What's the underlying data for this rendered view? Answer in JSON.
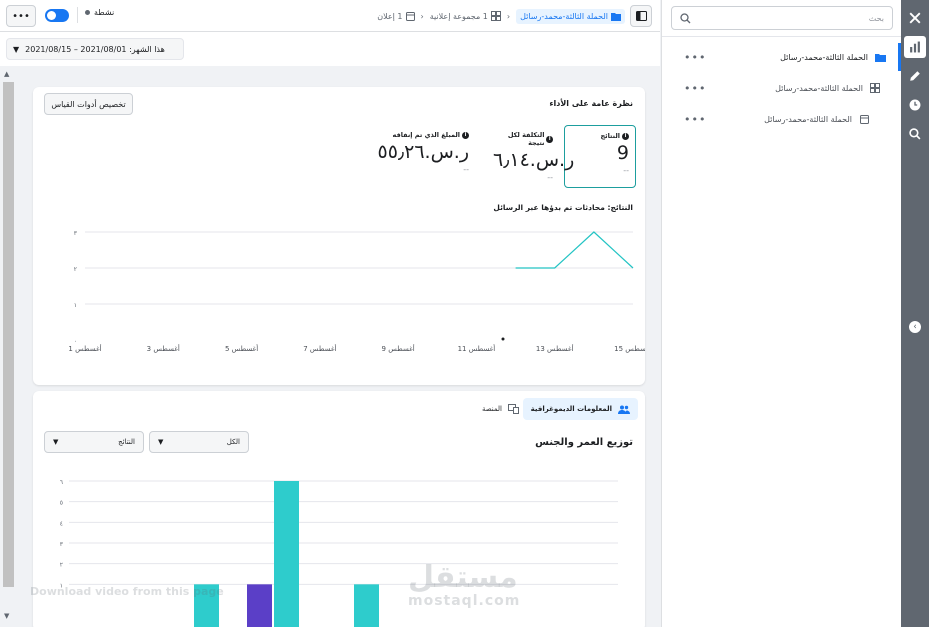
{
  "topbar": {
    "more_label": "•••",
    "status_label": "نشطة",
    "breadcrumbs": [
      {
        "label": "الحملة الثالثة-محمد-رسائل",
        "icon": "folder-icon"
      },
      {
        "label": "1 مجموعة إعلانية",
        "icon": "grid-icon"
      },
      {
        "label": "1 إعلان",
        "icon": "ad-icon"
      }
    ]
  },
  "date": {
    "label": "هذا الشهر: 01/‏08/‏2021 – 15/‏08/‏2021"
  },
  "nav": {
    "search_placeholder": "بحث",
    "items": [
      {
        "label": "الحملة الثالثة-محمد-رسائل",
        "icon": "folder-icon",
        "more": "•••"
      },
      {
        "label": "الحملة الثالثة-محمد-رسائل",
        "icon": "grid-icon",
        "more": "•••"
      },
      {
        "label": "الحملة الثالثة-محمد-رسائل",
        "icon": "ad-icon",
        "more": "•••"
      }
    ]
  },
  "rail": {
    "icons": [
      "close-icon",
      "chart-icon",
      "pencil-icon",
      "clock-icon",
      "search-zoom-icon"
    ],
    "collapse_icon": "chevron-left-icon"
  },
  "overview": {
    "title": "نظرة عامة على الأداء",
    "customize_label": "تخصيص أدوات القياس",
    "metrics": [
      {
        "label": "النتائج",
        "value": "9",
        "delta": "--"
      },
      {
        "label": "التكلفة لكل نتيجة",
        "value": "ر.س.٦٫١٤",
        "delta": "--"
      },
      {
        "label": "المبلغ الذي تم إنفاقه",
        "value": "ر.س.٥٥٫٢٦",
        "delta": "--"
      }
    ],
    "chart_title": "النتائج: محادثات تم بدؤها عبر الرسائل"
  },
  "demographics": {
    "tabs": [
      {
        "label": "المعلومات الديموغرافية",
        "icon": "people-icon"
      },
      {
        "label": "المنصة",
        "icon": "devices-icon"
      }
    ],
    "title": "توزيع العمر والجنس",
    "select_all": "الكل",
    "select_results": "النتائج"
  },
  "watermark": {
    "logo": "مستقل",
    "site": "mostaql.com",
    "hint": "Download video from this page"
  },
  "colors": {
    "accent": "#1877f2",
    "teal": "#2ecccc",
    "purple": "#5b3fc7",
    "line": "#23c4c4"
  },
  "chart_data": [
    {
      "type": "line",
      "title": "النتائج: محادثات تم بدؤها عبر الرسائل",
      "x": [
        "1 أغسطس",
        "2 أغسطس",
        "3 أغسطس",
        "4 أغسطس",
        "5 أغسطس",
        "6 أغسطس",
        "7 أغسطس",
        "8 أغسطس",
        "9 أغسطس",
        "10 أغسطس",
        "11 أغسطس",
        "12 أغسطس",
        "13 أغسطس",
        "14 أغسطس",
        "15 أغسطس"
      ],
      "xticks": [
        "1 أغسطس",
        "3 أغسطس",
        "5 أغسطس",
        "7 أغسطس",
        "9 أغسطس",
        "11 أغسطس",
        "13 أغسطس",
        "15 أغسطس"
      ],
      "series": [
        {
          "values": [
            null,
            null,
            null,
            null,
            null,
            null,
            null,
            null,
            null,
            null,
            null,
            2,
            2,
            3,
            2
          ]
        }
      ],
      "yticks": [
        "٠",
        "١",
        "٢",
        "٣"
      ],
      "ylim": [
        0,
        3
      ],
      "grid": true
    },
    {
      "type": "bar",
      "title": "توزيع العمر والجنس",
      "yticks": [
        "١",
        "٢",
        "٣",
        "٤",
        "٥",
        "٦"
      ],
      "ylim": [
        0,
        6
      ],
      "grid": true,
      "series": [
        {
          "color": "teal",
          "values": [
            1,
            6,
            1
          ]
        },
        {
          "color": "purple",
          "values": [
            1
          ]
        }
      ]
    }
  ]
}
